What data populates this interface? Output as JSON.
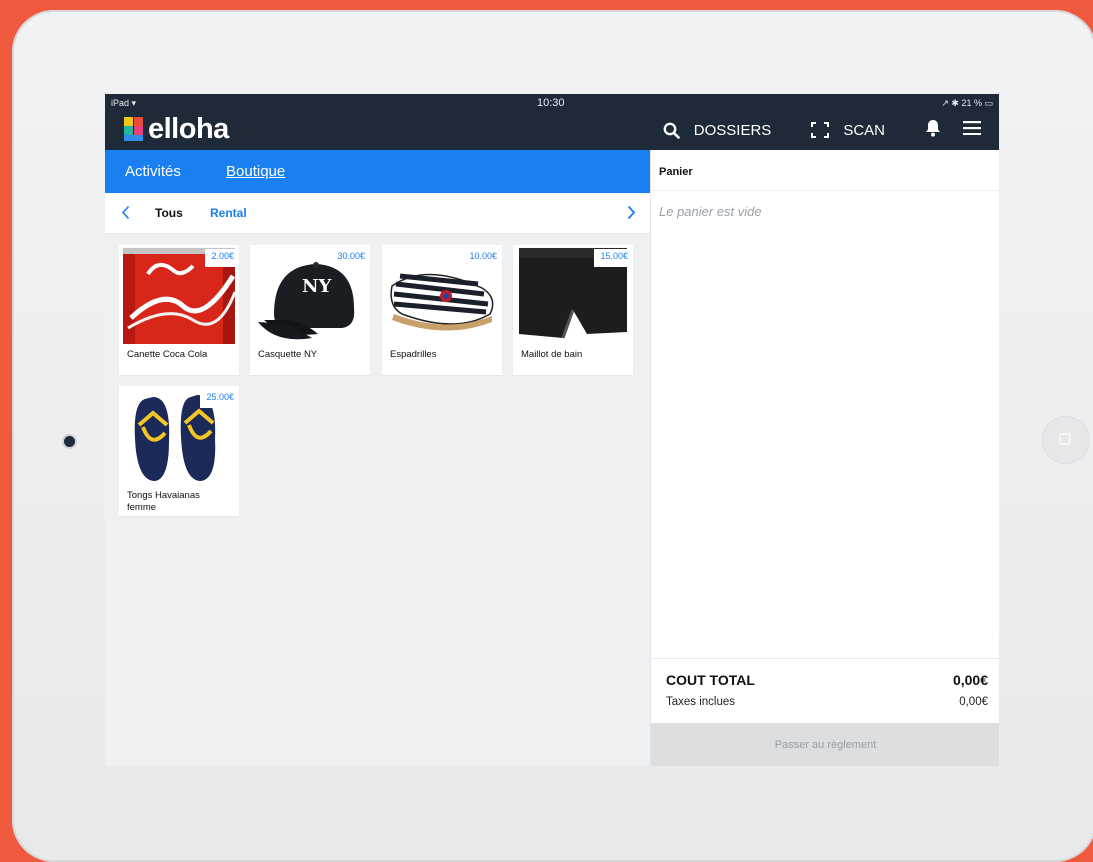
{
  "device": {
    "status_carrier": "iPad",
    "status_time": "10:30",
    "status_battery": "21 %"
  },
  "header": {
    "logo_text": "elloha",
    "search_label": "DOSSIERS",
    "scan_label": "SCAN"
  },
  "tabs": {
    "activites": "Activités",
    "boutique": "Boutique"
  },
  "categories": {
    "tous": "Tous",
    "rental": "Rental"
  },
  "products": [
    {
      "name": "Canette Coca Cola",
      "price": "2.00€",
      "icon": "coca-can"
    },
    {
      "name": "Casquette NY",
      "price": "30.00€",
      "icon": "ny-cap"
    },
    {
      "name": "Espadrilles",
      "price": "10.00€",
      "icon": "espadrille"
    },
    {
      "name": "Maillot de bain",
      "price": "15.00€",
      "icon": "swim-trunks"
    },
    {
      "name": "Tongs Havaianas femme",
      "price": "25.00€",
      "icon": "flip-flops"
    }
  ],
  "cart": {
    "title": "Panier",
    "empty_message": "Le panier est vide",
    "total_label": "COUT TOTAL",
    "total_value": "0,00€",
    "tax_label": "Taxes inclues",
    "tax_value": "0,00€",
    "pay_label": "Passer au règlement"
  },
  "colors": {
    "background": "#ef5a3f",
    "topbar": "#1f2a38",
    "accent": "#1a7ff0",
    "pay_button": "#dddedf"
  }
}
